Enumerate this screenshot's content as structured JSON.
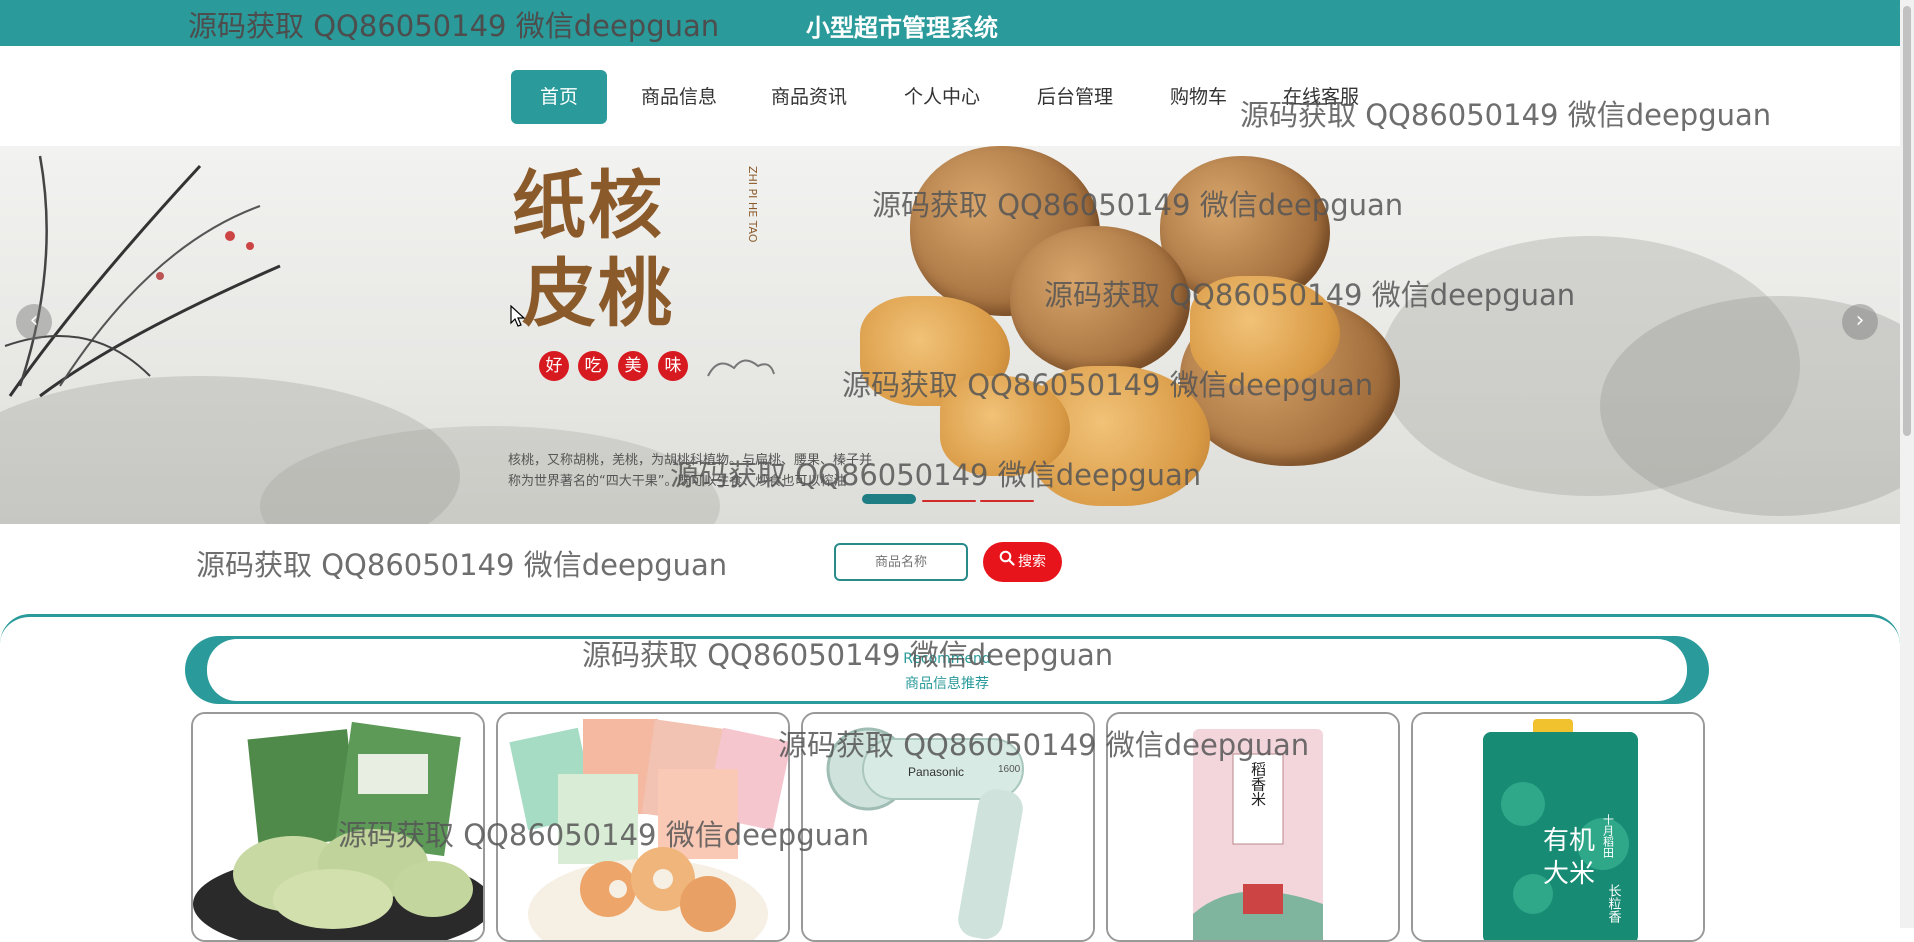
{
  "header": {
    "watermark": "源码获取 QQ86050149 微信deepguan",
    "site_title": "小型超市管理系统"
  },
  "nav": {
    "items": [
      {
        "label": "首页",
        "active": true
      },
      {
        "label": "商品信息",
        "active": false
      },
      {
        "label": "商品资讯",
        "active": false
      },
      {
        "label": "个人中心",
        "active": false
      },
      {
        "label": "后台管理",
        "active": false
      },
      {
        "label": "购物车",
        "active": false
      },
      {
        "label": "在线客服",
        "active": false
      }
    ]
  },
  "banner": {
    "brand_text": "纸核皮桃",
    "tags": [
      "好",
      "吃",
      "美",
      "味"
    ],
    "pinyin": "ZHI PI HE TAO",
    "description_line1": "核桃，又称胡桃，羌桃，为胡桃科植物。与扁桃、腰果、榛子并",
    "description_line2": "称为世界著名的“四大干果”。既可以生食、炒食也可以榨油",
    "prev_arrow": "‹",
    "next_arrow": "›",
    "slide_count": 3,
    "active_slide": 1,
    "accent_color": "#1f7d84",
    "inactive_dot_color": "#d12a2a"
  },
  "search": {
    "placeholder": "商品名称",
    "button_label": "搜索",
    "button_icon": "search-icon",
    "button_color": "#e8141c"
  },
  "recommend": {
    "title_en": "Recommend",
    "title_cn": "商品信息推荐"
  },
  "products": [
    {
      "image": "mooncake-pastry",
      "alt": "绿茶饼"
    },
    {
      "image": "snack-crisps",
      "alt": "零食"
    },
    {
      "image": "hair-dryer",
      "alt": "Panasonic 1600"
    },
    {
      "image": "rice-bag-pink",
      "alt": "稻香米"
    },
    {
      "image": "rice-bag-green",
      "alt": "有机大米"
    }
  ],
  "product_text": {
    "dryer_brand": "Panasonic",
    "dryer_model": "1600",
    "rice1_text": "稻香米",
    "rice2_line1": "有机",
    "rice2_line2": "大米",
    "rice2_side1": "十月稻田",
    "rice2_side2": "长粒香"
  },
  "watermarks": [
    "源码获取 QQ86050149 微信deepguan",
    "源码获取 QQ86050149 微信deepguan",
    "源码获取 QQ86050149 微信deepguan",
    "源码获取 QQ86050149 微信deepguan",
    "源码获取 QQ86050149 微信deepguan",
    "源码获取 QQ86050149 微信deepguan",
    "源码获取 QQ86050149 微信deepguan",
    "源码获取 QQ86050149 微信deepguan",
    "源码获取 QQ86050149 微信deepguan"
  ],
  "colors": {
    "primary": "#2a9a9a",
    "search_red": "#e8141c"
  }
}
